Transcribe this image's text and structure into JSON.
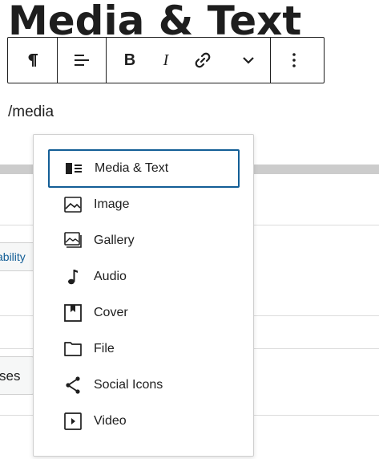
{
  "block": {
    "title": "Media & Text",
    "slash_input": "/media"
  },
  "toolbar": {
    "paragraph_icon": "pilcrow-icon",
    "align_icon": "align-icon",
    "bold_label": "B",
    "italic_label": "I",
    "link_icon": "link-icon",
    "more_icon": "chevron-down-icon",
    "options_icon": "more-vertical-icon"
  },
  "background": {
    "chip1_text": "ability",
    "chip2_text": "ses"
  },
  "autocomplete": {
    "items": [
      {
        "label": "Media & Text",
        "icon": "media-text-icon",
        "selected": true
      },
      {
        "label": "Image",
        "icon": "image-icon"
      },
      {
        "label": "Gallery",
        "icon": "gallery-icon"
      },
      {
        "label": "Audio",
        "icon": "audio-icon"
      },
      {
        "label": "Cover",
        "icon": "cover-icon"
      },
      {
        "label": "File",
        "icon": "file-icon"
      },
      {
        "label": "Social Icons",
        "icon": "share-icon"
      },
      {
        "label": "Video",
        "icon": "video-icon"
      }
    ]
  },
  "colors": {
    "focus": "#135e96",
    "text": "#1e1e1e",
    "band": "#cccccc"
  }
}
